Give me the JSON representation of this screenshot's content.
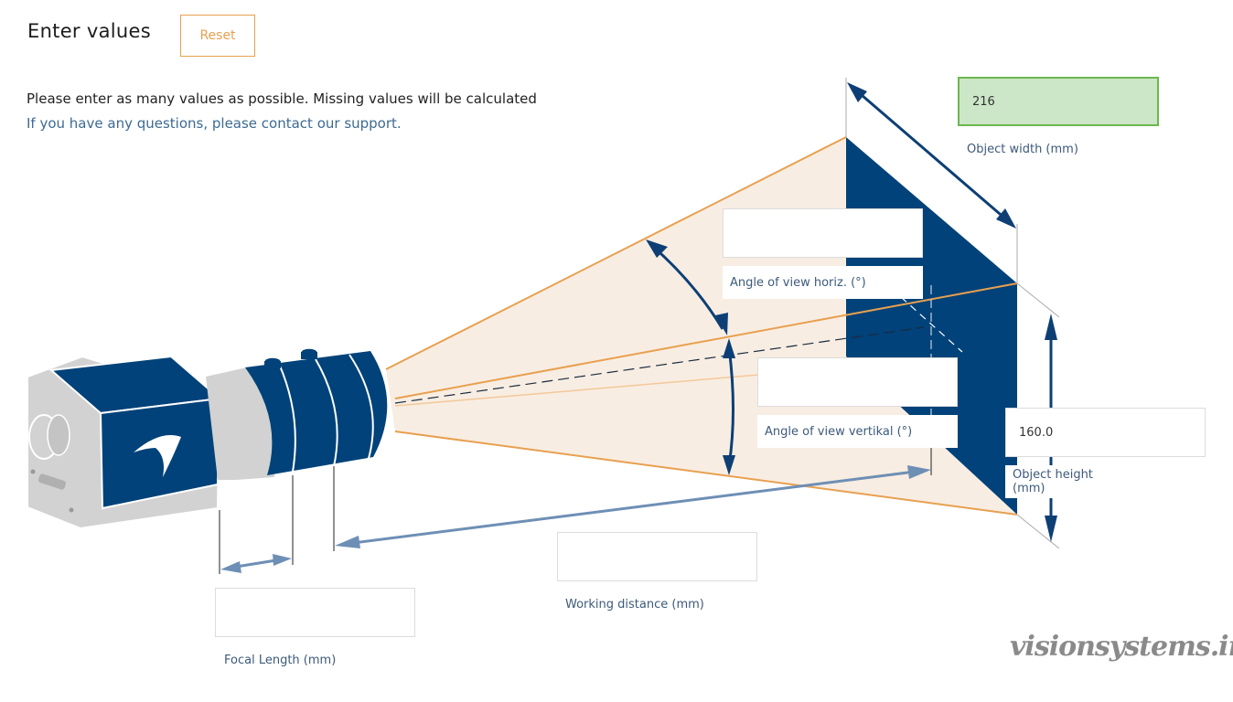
{
  "header": {
    "title": "Enter values",
    "reset_label": "Reset"
  },
  "intro": {
    "instructions": "Please enter as many values as possible. Missing values will be calculated",
    "support_link": "If you have any questions, please contact our support."
  },
  "fields": {
    "object_width": {
      "label": "Object width (mm)",
      "value": "216",
      "state": "valid"
    },
    "angle_horizontal": {
      "label": "Angle of view horiz. (°)",
      "value": ""
    },
    "angle_vertical": {
      "label": "Angle of view vertikal (°)",
      "value": ""
    },
    "object_height": {
      "label": "Object height (mm)",
      "value": "160.0"
    },
    "working_distance": {
      "label": "Working distance (mm)",
      "value": ""
    },
    "focal_length": {
      "label": "Focal Length (mm)",
      "value": ""
    }
  },
  "colors": {
    "brand_blue": "#004279",
    "accent_orange": "#e8a050",
    "beam_fill": "#f8ede2",
    "valid_green_bg": "#cce6c8",
    "valid_green_border": "#6cb850",
    "label_blue": "#3d5a7a",
    "dimension_arrow": "#6e8fb5"
  },
  "watermark": "visionsystems.ir"
}
